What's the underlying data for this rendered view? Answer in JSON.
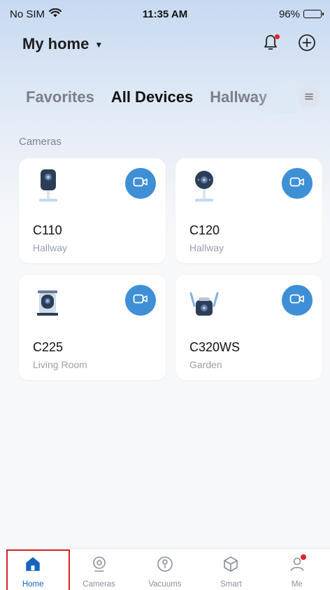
{
  "status": {
    "carrier": "No SIM",
    "time": "11:35 AM",
    "battery": "96%",
    "battery_level": 0.96
  },
  "header": {
    "title": "My home"
  },
  "tabs": [
    {
      "label": "Favorites",
      "active": false
    },
    {
      "label": "All Devices",
      "active": true
    },
    {
      "label": "Hallway",
      "active": false
    }
  ],
  "section": {
    "title": "Cameras"
  },
  "devices": [
    {
      "name": "C110",
      "room": "Hallway"
    },
    {
      "name": "C120",
      "room": "Hallway"
    },
    {
      "name": "C225",
      "room": "Living Room"
    },
    {
      "name": "C320WS",
      "room": "Garden"
    }
  ],
  "tabbar": [
    {
      "label": "Home",
      "icon": "home-icon",
      "active": true
    },
    {
      "label": "Cameras",
      "icon": "camera-icon",
      "active": false
    },
    {
      "label": "Vacuums",
      "icon": "vacuum-icon",
      "active": false
    },
    {
      "label": "Smart",
      "icon": "smart-cube-icon",
      "active": false
    },
    {
      "label": "Me",
      "icon": "person-icon",
      "active": false
    }
  ],
  "colors": {
    "accent": "#3e8fd6",
    "active_tab": "#1565c0",
    "badge": "#e8202a",
    "highlight": "#d81f26"
  }
}
